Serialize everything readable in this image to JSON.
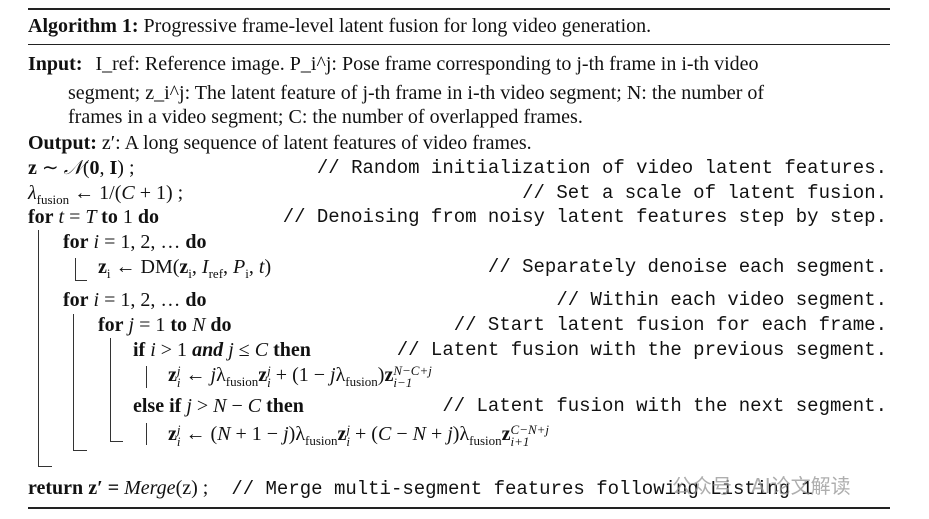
{
  "algorithm": {
    "label": "Algorithm 1:",
    "title": "Progressive frame-level latent fusion for long video generation."
  },
  "input": {
    "label": "Input:",
    "lines": [
      "I_ref: Reference image. P_i^j: Pose frame corresponding to j-th frame in i-th video",
      "segment; z_i^j: The latent feature of j-th frame in i-th video segment; N: the number of",
      "frames in a video segment; C: the number of overlapped frames."
    ]
  },
  "output": {
    "label": "Output:",
    "text": "z′: A long sequence of latent features of video frames."
  },
  "lines": [
    {
      "indent": 0,
      "segs": [
        [
          "b",
          "z"
        ],
        [
          "r",
          " ∼ "
        ],
        [
          "m",
          "𝒩"
        ],
        [
          "r",
          "("
        ],
        [
          "b",
          "0"
        ],
        [
          "r",
          ", "
        ],
        [
          "b",
          "I"
        ],
        [
          "r",
          ") ;"
        ]
      ],
      "comment": "// Random initialization of video latent features."
    },
    {
      "indent": 0,
      "segs": [
        [
          "m",
          "λ"
        ],
        [
          "sub",
          "fusion"
        ],
        [
          "r",
          " ← 1/("
        ],
        [
          "m",
          "C"
        ],
        [
          "r",
          " + 1) ;"
        ]
      ],
      "comment": "// Set a scale of latent fusion."
    },
    {
      "indent": 0,
      "segs": [
        [
          "k",
          "for"
        ],
        [
          "m",
          " t "
        ],
        [
          "r",
          "= "
        ],
        [
          "m",
          "T "
        ],
        [
          "k",
          "to"
        ],
        [
          "r",
          " 1 "
        ],
        [
          "k",
          "do"
        ]
      ],
      "comment": "// Denoising from noisy latent features step by step."
    },
    {
      "indent": 1,
      "segs": [
        [
          "k",
          "for"
        ],
        [
          "m",
          " i "
        ],
        [
          "r",
          "= 1, 2, … "
        ],
        [
          "k",
          "do"
        ]
      ],
      "comment": ""
    },
    {
      "indent": 2,
      "segs": [
        [
          "b",
          "z"
        ],
        [
          "sub",
          "i"
        ],
        [
          "r",
          " ← DM("
        ],
        [
          "b",
          "z"
        ],
        [
          "sub",
          "i"
        ],
        [
          "r",
          ", "
        ],
        [
          "m",
          "I"
        ],
        [
          "sub",
          "ref"
        ],
        [
          "r",
          ", "
        ],
        [
          "m",
          "P"
        ],
        [
          "sub",
          "i"
        ],
        [
          "r",
          ", "
        ],
        [
          "m",
          "t"
        ],
        [
          "r",
          ")"
        ]
      ],
      "comment": "// Separately denoise each segment."
    },
    {
      "indent": 1,
      "segs": [
        [
          "k",
          "for"
        ],
        [
          "m",
          " i "
        ],
        [
          "r",
          "= 1, 2, … "
        ],
        [
          "k",
          "do"
        ]
      ],
      "comment": "// Within each video segment."
    },
    {
      "indent": 2,
      "segs": [
        [
          "k",
          "for"
        ],
        [
          "m",
          " j "
        ],
        [
          "r",
          "= 1 "
        ],
        [
          "k",
          "to"
        ],
        [
          "m",
          " N "
        ],
        [
          "k",
          "do"
        ]
      ],
      "comment": "// Start latent fusion for each frame."
    },
    {
      "indent": 3,
      "segs": [
        [
          "k",
          "if"
        ],
        [
          "m",
          " i "
        ],
        [
          "r",
          "> 1 "
        ],
        [
          "ki",
          "and"
        ],
        [
          "m",
          " j "
        ],
        [
          "r",
          "≤ "
        ],
        [
          "m",
          "C "
        ],
        [
          "k",
          "then"
        ]
      ],
      "comment": "// Latent fusion with the previous segment."
    },
    {
      "indent": 4,
      "segs": [
        [
          "b",
          "z"
        ],
        [
          "ss",
          "j|i"
        ],
        [
          "r",
          " ← "
        ],
        [
          "m",
          "j"
        ],
        [
          "r",
          "λ"
        ],
        [
          "sub",
          "fusion"
        ],
        [
          "b",
          "z"
        ],
        [
          "ss",
          "j|i"
        ],
        [
          "r",
          " + (1 − "
        ],
        [
          "m",
          "j"
        ],
        [
          "r",
          "λ"
        ],
        [
          "sub",
          "fusion"
        ],
        [
          "r",
          ")"
        ],
        [
          "b",
          "z"
        ],
        [
          "ss",
          "N−C+j|i−1"
        ]
      ],
      "comment": ""
    },
    {
      "indent": 3,
      "segs": [
        [
          "k",
          "else if"
        ],
        [
          "m",
          " j "
        ],
        [
          "r",
          "> "
        ],
        [
          "m",
          "N "
        ],
        [
          "r",
          "− "
        ],
        [
          "m",
          "C "
        ],
        [
          "k",
          "then"
        ]
      ],
      "comment": "// Latent fusion with the next segment."
    },
    {
      "indent": 4,
      "segs": [
        [
          "b",
          "z"
        ],
        [
          "ss",
          "j|i"
        ],
        [
          "r",
          " ← ("
        ],
        [
          "m",
          "N"
        ],
        [
          "r",
          " + 1 − "
        ],
        [
          "m",
          "j"
        ],
        [
          "r",
          ")λ"
        ],
        [
          "sub",
          "fusion"
        ],
        [
          "b",
          "z"
        ],
        [
          "ss",
          "j|i"
        ],
        [
          "r",
          " + ("
        ],
        [
          "m",
          "C"
        ],
        [
          "r",
          " − "
        ],
        [
          "m",
          "N"
        ],
        [
          "r",
          " + "
        ],
        [
          "m",
          "j"
        ],
        [
          "r",
          ")λ"
        ],
        [
          "sub",
          "fusion"
        ],
        [
          "b",
          "z"
        ],
        [
          "ss",
          "C−N+j|i+1"
        ]
      ],
      "comment": ""
    }
  ],
  "return_line": {
    "keyword": "return",
    "expr": " z′ = ",
    "func": "Merge",
    "args": "(z) ;",
    "comment": "// Merge multi-segment features following Listing 1"
  },
  "watermark": "公众号 · AI论文解读"
}
